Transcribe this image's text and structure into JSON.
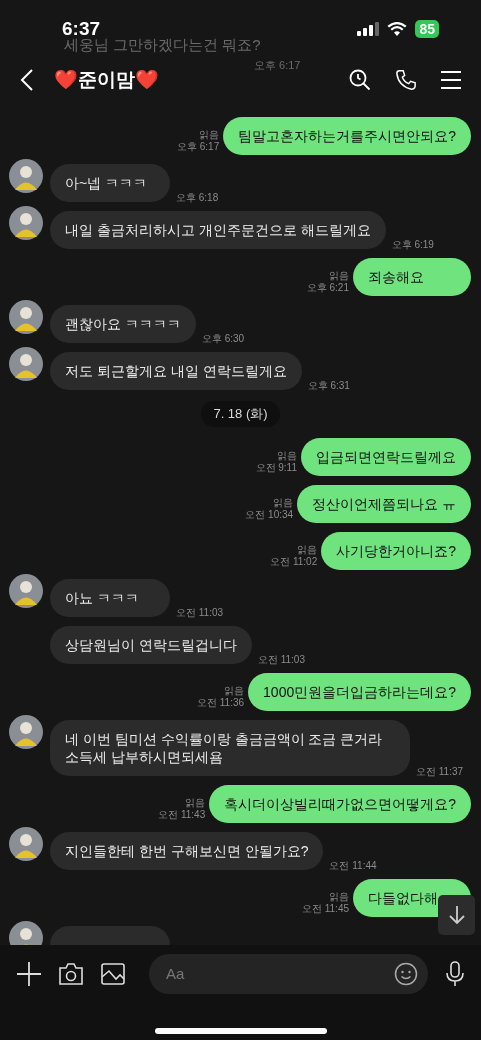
{
  "status_bar": {
    "time": "6:37",
    "battery": "85"
  },
  "background_messages": [
    {
      "text": "세웅님 그만하겠다는건 뭐죠?"
    },
    {
      "text": "오후 6:17"
    }
  ],
  "header": {
    "title": "❤️준이맘❤️"
  },
  "messages": [
    {
      "kind": "sent",
      "text": "팀말고혼자하는거를주시면안되요?",
      "read": "읽음",
      "time": "오후 6:17"
    },
    {
      "kind": "received",
      "avatar": true,
      "text": "아~넵 ㅋㅋㅋ",
      "time": "오후 6:18"
    },
    {
      "kind": "received",
      "avatar": true,
      "text": "내일 출금처리하시고 개인주문건으로 해드릴게요",
      "time": "오후 6:19"
    },
    {
      "kind": "sent",
      "text": "죄송해요",
      "read": "읽음",
      "time": "오후 6:21"
    },
    {
      "kind": "received",
      "avatar": true,
      "text": "괜찮아요 ㅋㅋㅋㅋ",
      "time": "오후 6:30"
    },
    {
      "kind": "received",
      "avatar": true,
      "text": "저도 퇴근할게요 내일 연락드릴게요",
      "time": "오후 6:31"
    },
    {
      "kind": "date",
      "text": "7. 18 (화)"
    },
    {
      "kind": "sent",
      "text": "입금되면연락드릴께요",
      "read": "읽음",
      "time": "오전 9:11"
    },
    {
      "kind": "sent",
      "text": "정산이언제쯤되나요 ㅠ",
      "read": "읽음",
      "time": "오전 10:34"
    },
    {
      "kind": "sent",
      "text": "사기당한거아니죠?",
      "read": "읽음",
      "time": "오전 11:02"
    },
    {
      "kind": "received",
      "avatar": true,
      "text": "아뇨 ㅋㅋㅋ",
      "time": "오전 11:03"
    },
    {
      "kind": "received",
      "avatar": false,
      "text": "상담원님이 연락드릴겁니다",
      "time": "오전 11:03"
    },
    {
      "kind": "sent",
      "text": "1000민원을더입금하라는데요?",
      "read": "읽음",
      "time": "오전 11:36"
    },
    {
      "kind": "received",
      "avatar": true,
      "text": "네 이번 팀미션 수익률이랑 출금금액이 조금 큰거라 소득세 납부하시면되세욤",
      "time": "오전 11:37"
    },
    {
      "kind": "sent",
      "text": "혹시더이상빌리때가없으면어떻게요?",
      "read": "읽음",
      "time": "오전 11:43"
    },
    {
      "kind": "received",
      "avatar": true,
      "text": "지인들한테 한번 구해보신면 안될가요?",
      "time": "오전 11:44"
    },
    {
      "kind": "sent",
      "text": "다들없다해",
      "read": "읽음",
      "time": "오전 11:45"
    },
    {
      "kind": "received",
      "avatar": true
    }
  ],
  "composer": {
    "placeholder": "Aa"
  }
}
